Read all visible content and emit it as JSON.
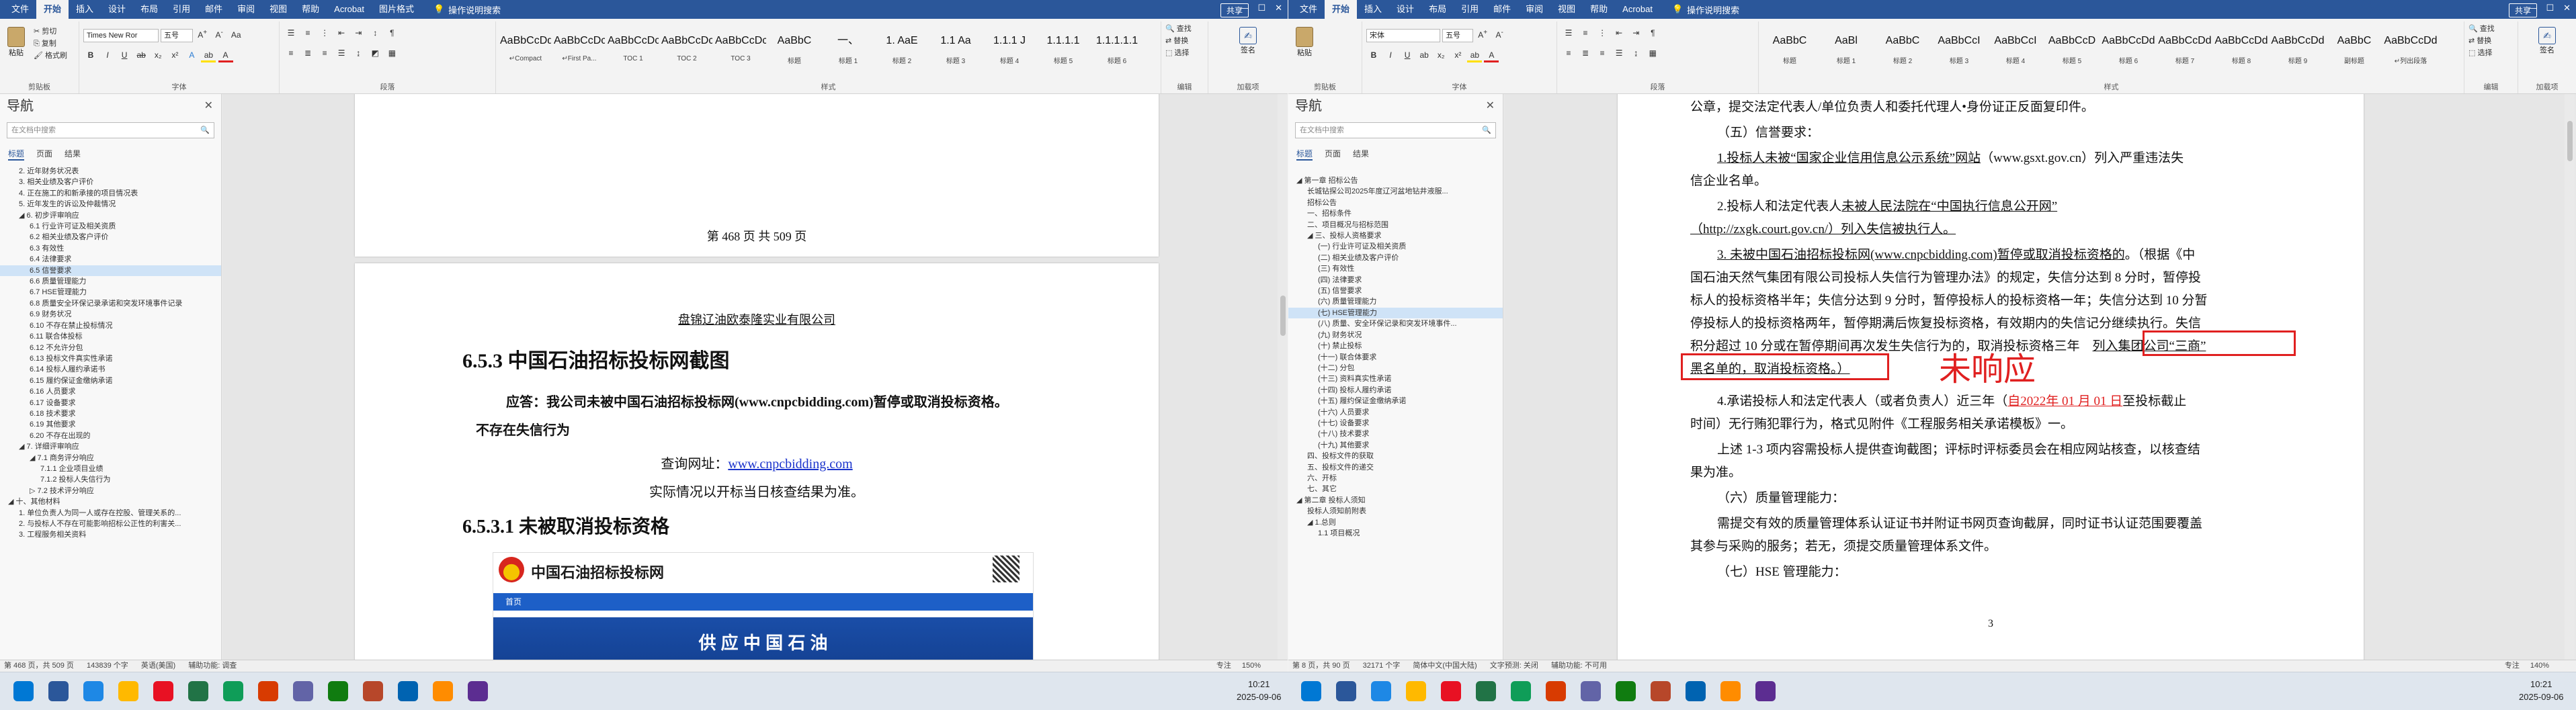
{
  "left": {
    "ribbon_tabs": [
      "文件",
      "开始",
      "插入",
      "设计",
      "布局",
      "引用",
      "邮件",
      "审阅",
      "视图",
      "帮助",
      "Acrobat",
      "图片格式"
    ],
    "active_tab": "开始",
    "search_label": "操作说明搜索",
    "share_label": "共享",
    "font_name": "Times New Ror",
    "font_size": "五号",
    "clipboard": {
      "paste": "粘贴",
      "cut": "剪切",
      "copy": "复制",
      "painter": "格式刷",
      "label": "剪贴板"
    },
    "font_group_label": "字体",
    "para_group_label": "段落",
    "styles_group_label": "样式",
    "styles": [
      {
        "preview": "AaBbCcDd",
        "name": "↵Compact"
      },
      {
        "preview": "AaBbCcDc",
        "name": "↵First Pa..."
      },
      {
        "preview": "AaBbCcDc",
        "name": "TOC 1"
      },
      {
        "preview": "AaBbCcDc",
        "name": "TOC 2"
      },
      {
        "preview": "AaBbCcDc",
        "name": "TOC 3"
      },
      {
        "preview": "AaBbC",
        "name": "标题"
      },
      {
        "preview": "一、",
        "name": "标题 1"
      },
      {
        "preview": "1. AaE",
        "name": "标题 2"
      },
      {
        "preview": "1.1 Aa",
        "name": "标题 3"
      },
      {
        "preview": "1.1.1 J",
        "name": "标题 4"
      },
      {
        "preview": "1.1.1.1",
        "name": "标题 5"
      },
      {
        "preview": "1.1.1.1.1",
        "name": "标题 6"
      }
    ],
    "editing": {
      "find": "查找",
      "replace": "替换",
      "select": "选择",
      "label": "编辑"
    },
    "pdf": {
      "create": "创建并共享 Adobe PDF",
      "label": "Adobe Acrobat"
    },
    "sign": {
      "name": "签名",
      "label": "加载项"
    },
    "nav": {
      "title": "导航",
      "search_placeholder": "在文档中搜索",
      "tabs": [
        "标题",
        "页面",
        "结果"
      ],
      "items": [
        {
          "text": "2. 近年财务状况表",
          "level": 1
        },
        {
          "text": "3. 相关业绩及客户评价",
          "level": 1
        },
        {
          "text": "4. 正在施工的和新承接的项目情况表",
          "level": 1
        },
        {
          "text": "5. 近年发生的诉讼及仲裁情况",
          "level": 1
        },
        {
          "text": "◢ 6. 初步评审响应",
          "level": 1
        },
        {
          "text": "6.1 行业许可证及相关资质",
          "level": 2
        },
        {
          "text": "6.2 相关业绩及客户评价",
          "level": 2
        },
        {
          "text": "6.3 有效性",
          "level": 2
        },
        {
          "text": "6.4 法律要求",
          "level": 2
        },
        {
          "text": "6.5 信誉要求",
          "level": 2,
          "selected": true
        },
        {
          "text": "6.6 质量管理能力",
          "level": 2
        },
        {
          "text": "6.7 HSE管理能力",
          "level": 2
        },
        {
          "text": "6.8 质量安全环保记录承诺和突发环境事件记录",
          "level": 2
        },
        {
          "text": "6.9 财务状况",
          "level": 2
        },
        {
          "text": "6.10 不存在禁止投标情况",
          "level": 2
        },
        {
          "text": "6.11 联合体投标",
          "level": 2
        },
        {
          "text": "6.12 不允许分包",
          "level": 2
        },
        {
          "text": "6.13 投标文件真实性承诺",
          "level": 2
        },
        {
          "text": "6.14 投标人履约承诺书",
          "level": 2
        },
        {
          "text": "6.15 履约保证金缴纳承诺",
          "level": 2
        },
        {
          "text": "6.16 人员要求",
          "level": 2
        },
        {
          "text": "6.17 设备要求",
          "level": 2
        },
        {
          "text": "6.18 技术要求",
          "level": 2
        },
        {
          "text": "6.19 其他要求",
          "level": 2
        },
        {
          "text": "6.20 不存在出现的",
          "level": 2
        },
        {
          "text": "◢ 7. 详细评审响应",
          "level": 1
        },
        {
          "text": "◢ 7.1 商务评分响应",
          "level": 2
        },
        {
          "text": "7.1.1 企业项目业绩",
          "level": 3
        },
        {
          "text": "7.1.2 投标人失信行为",
          "level": 3
        },
        {
          "text": "▷ 7.2 技术评分响应",
          "level": 2
        },
        {
          "text": "◢ 十、其他材料",
          "level": 0
        },
        {
          "text": "1. 单位负责人为同一人或存在控股、管理关系的...",
          "level": 1
        },
        {
          "text": "2. 与投标人不存在可能影响招标公正性的利害关...",
          "level": 1
        },
        {
          "text": "3. 工程服务相关资料",
          "level": 1
        }
      ]
    },
    "doc": {
      "footer_page": "第 468 页 共 509 页",
      "company_line": "盘锦辽油欧泰隆实业有限公司",
      "heading1": "6.5.3   中国石油招标投标网截图",
      "response_text": "应答：我公司未被中国石油招标投标网(www.cnpcbidding.com)暂停或取消投标资格。",
      "response_cont": "不存在失信行为",
      "query_label": "查询网址：",
      "query_url": "www.cnpcbidding.com",
      "result_line": "实际情况以开标当日核查结果为准。",
      "heading2": "6.5.3.1   未被取消投标资格",
      "site_title": "中国石油招标投标网",
      "site_nav": "首页",
      "site_banner": "供 应 中 国 石 油"
    },
    "status": {
      "page": "第 468 页，共 509 页",
      "words": "143839 个字",
      "mode": "英语(美国)",
      "access": "辅助功能: 调查",
      "focus": "专注",
      "zoom": "150%"
    }
  },
  "right": {
    "ribbon_tabs": [
      "文件",
      "开始",
      "插入",
      "设计",
      "布局",
      "引用",
      "邮件",
      "审阅",
      "视图",
      "帮助",
      "Acrobat"
    ],
    "active_tab": "开始",
    "search_label": "操作说明搜索",
    "share_label": "共享",
    "font_name": "宋体",
    "font_size": "五号",
    "clipboard": {
      "paste": "粘贴",
      "label": "剪贴板"
    },
    "font_group_label": "字体",
    "para_group_label": "段落",
    "styles_group_label": "样式",
    "styles": [
      {
        "preview": "AaBbC",
        "name": "标题"
      },
      {
        "preview": "AaBl",
        "name": "标题 1"
      },
      {
        "preview": "AaBbC",
        "name": "标题 2"
      },
      {
        "preview": "AaBbCcI",
        "name": "标题 3"
      },
      {
        "preview": "AaBbCcI",
        "name": "标题 4"
      },
      {
        "preview": "AaBbCcD",
        "name": "标题 5"
      },
      {
        "preview": "AaBbCcDd",
        "name": "标题 6"
      },
      {
        "preview": "AaBbCcDd",
        "name": "标题 7"
      },
      {
        "preview": "AaBbCcDd",
        "name": "标题 8"
      },
      {
        "preview": "AaBbCcDd",
        "name": "标题 9"
      },
      {
        "preview": "AaBbC",
        "name": "副标题"
      },
      {
        "preview": "AaBbCcDd",
        "name": "↵列出段落"
      }
    ],
    "editing": {
      "find": "查找",
      "replace": "替换",
      "select": "选择",
      "label": "编辑"
    },
    "sign": {
      "name": "签名",
      "label": "加载项"
    },
    "nav": {
      "title": "导航",
      "search_placeholder": "在文档中搜索",
      "tabs": [
        "标题",
        "页面",
        "结果"
      ],
      "items": [
        {
          "text": "◢ 第一章 招标公告",
          "level": 0
        },
        {
          "text": "长城钻探公司2025年度辽河盆地钻井液服...",
          "level": 1
        },
        {
          "text": "招标公告",
          "level": 1
        },
        {
          "text": "一、招标条件",
          "level": 1
        },
        {
          "text": "二、项目概况与招标范围",
          "level": 1
        },
        {
          "text": "◢ 三、投标人资格要求",
          "level": 1
        },
        {
          "text": "(一) 行业许可证及相关资质",
          "level": 2
        },
        {
          "text": "(二) 相关业绩及客户评价",
          "level": 2
        },
        {
          "text": "(三) 有效性",
          "level": 2
        },
        {
          "text": "(四) 法律要求",
          "level": 2
        },
        {
          "text": "(五) 信誉要求",
          "level": 2
        },
        {
          "text": "(六) 质量管理能力",
          "level": 2
        },
        {
          "text": "(七) HSE管理能力",
          "level": 2,
          "selected": true
        },
        {
          "text": "(八) 质量、安全环保记录和突发环境事件...",
          "level": 2
        },
        {
          "text": "(九) 财务状况",
          "level": 2
        },
        {
          "text": "(十) 禁止投标",
          "level": 2
        },
        {
          "text": "(十一) 联合体要求",
          "level": 2
        },
        {
          "text": "(十二) 分包",
          "level": 2
        },
        {
          "text": "(十三) 资料真实性承诺",
          "level": 2
        },
        {
          "text": "(十四) 投标人履约承诺",
          "level": 2
        },
        {
          "text": "(十五) 履约保证金缴纳承诺",
          "level": 2
        },
        {
          "text": "(十六) 人员要求",
          "level": 2
        },
        {
          "text": "(十七) 设备要求",
          "level": 2
        },
        {
          "text": "(十八) 技术要求",
          "level": 2
        },
        {
          "text": "(十九) 其他要求",
          "level": 2
        },
        {
          "text": "四、投标文件的获取",
          "level": 1
        },
        {
          "text": "五、投标文件的递交",
          "level": 1
        },
        {
          "text": "六、开标",
          "level": 1
        },
        {
          "text": "七、其它",
          "level": 1
        },
        {
          "text": "◢ 第二章 投标人须知",
          "level": 0
        },
        {
          "text": "投标人须知前附表",
          "level": 1
        },
        {
          "text": "◢ 1.总则",
          "level": 1
        },
        {
          "text": "1.1 项目概况",
          "level": 2
        }
      ]
    },
    "doc": {
      "line1": "公章，提交法定代表人/单位负责人和委托代理人•身份证正反面复印件。",
      "heading5": "（五）信誉要求：",
      "p1a": "1.投标人未被“国家企业信用信息公示系统”网站",
      "p1b": "（www.gsxt.gov.cn）列入严重违法失",
      "p1c": "信企业名单。",
      "p2a": "2.投标人和法定代表人",
      "p2b": "未被人民法院在“中国执行信息公开网”",
      "p2c": "（http://zxgk.court.gov.cn/）列入失信被执行人。",
      "p3a": "3. 未被中国石油招标投标网(www.cnpcbidding.com)暂停或取消投标资格的",
      "p3b": "。（根据《中",
      "p3c": "国石油天然气集团有限公司投标人失信行为管理办法》的规定，失信分达到 8 分时，暂停投",
      "p3d": "标人的投标资格半年；失信分达到 9 分时，暂停投标人的投标资格一年；失信分达到 10 分暂",
      "p3e": "停投标人的投标资格两年，暂停期满后恢复投标资格，有效期内的失信记分继续执行。失信",
      "p3f": "积分超过 10 分或在暂停期间再次发生失信行为的，取消投标资格三年",
      "p3g": "列入集团公司“三商”",
      "p3h": "黑名单的，取消投标资格。）",
      "annotation": "未响应",
      "p4a": "4.承诺投标人和法定代表人（或者负责人）近三年（",
      "p4b": "自2022年 01 月 01 日",
      "p4c": "至投标截止",
      "p4d": "时间）无行贿犯罪行为，格式见附件《工程服务相关承诺模板》一。",
      "p5a": "上述 1-3 项内容需投标人提供查询截图；评标时评标委员会在相应网站核查，以核查结",
      "p5b": "果为准。",
      "heading6": "（六）质量管理能力：",
      "p6a": "需提交有效的质量管理体系认证证书并附证书网页查询截屏，同时证书认证范围要覆盖",
      "p6b": "其参与采购的服务；若无，须提交质量管理体系文件。",
      "heading7": "（七）HSE 管理能力：",
      "page_num": "3"
    },
    "status": {
      "page": "第 8 页，共 90 页",
      "words": "32171 个字",
      "lang": "简体中文(中国大陆)",
      "text_predict": "文字预测: 关闭",
      "access": "辅助功能: 不可用",
      "focus": "专注",
      "zoom": "140%"
    }
  },
  "taskbar": {
    "left_clock": {
      "time": "10:21",
      "date": "2025-09-06"
    },
    "right_clock": {
      "time": "10:21",
      "date": "2025-09-06"
    }
  },
  "colors": {
    "word_blue": "#2b579a",
    "link": "#1a33cc",
    "red": "#e02020"
  }
}
